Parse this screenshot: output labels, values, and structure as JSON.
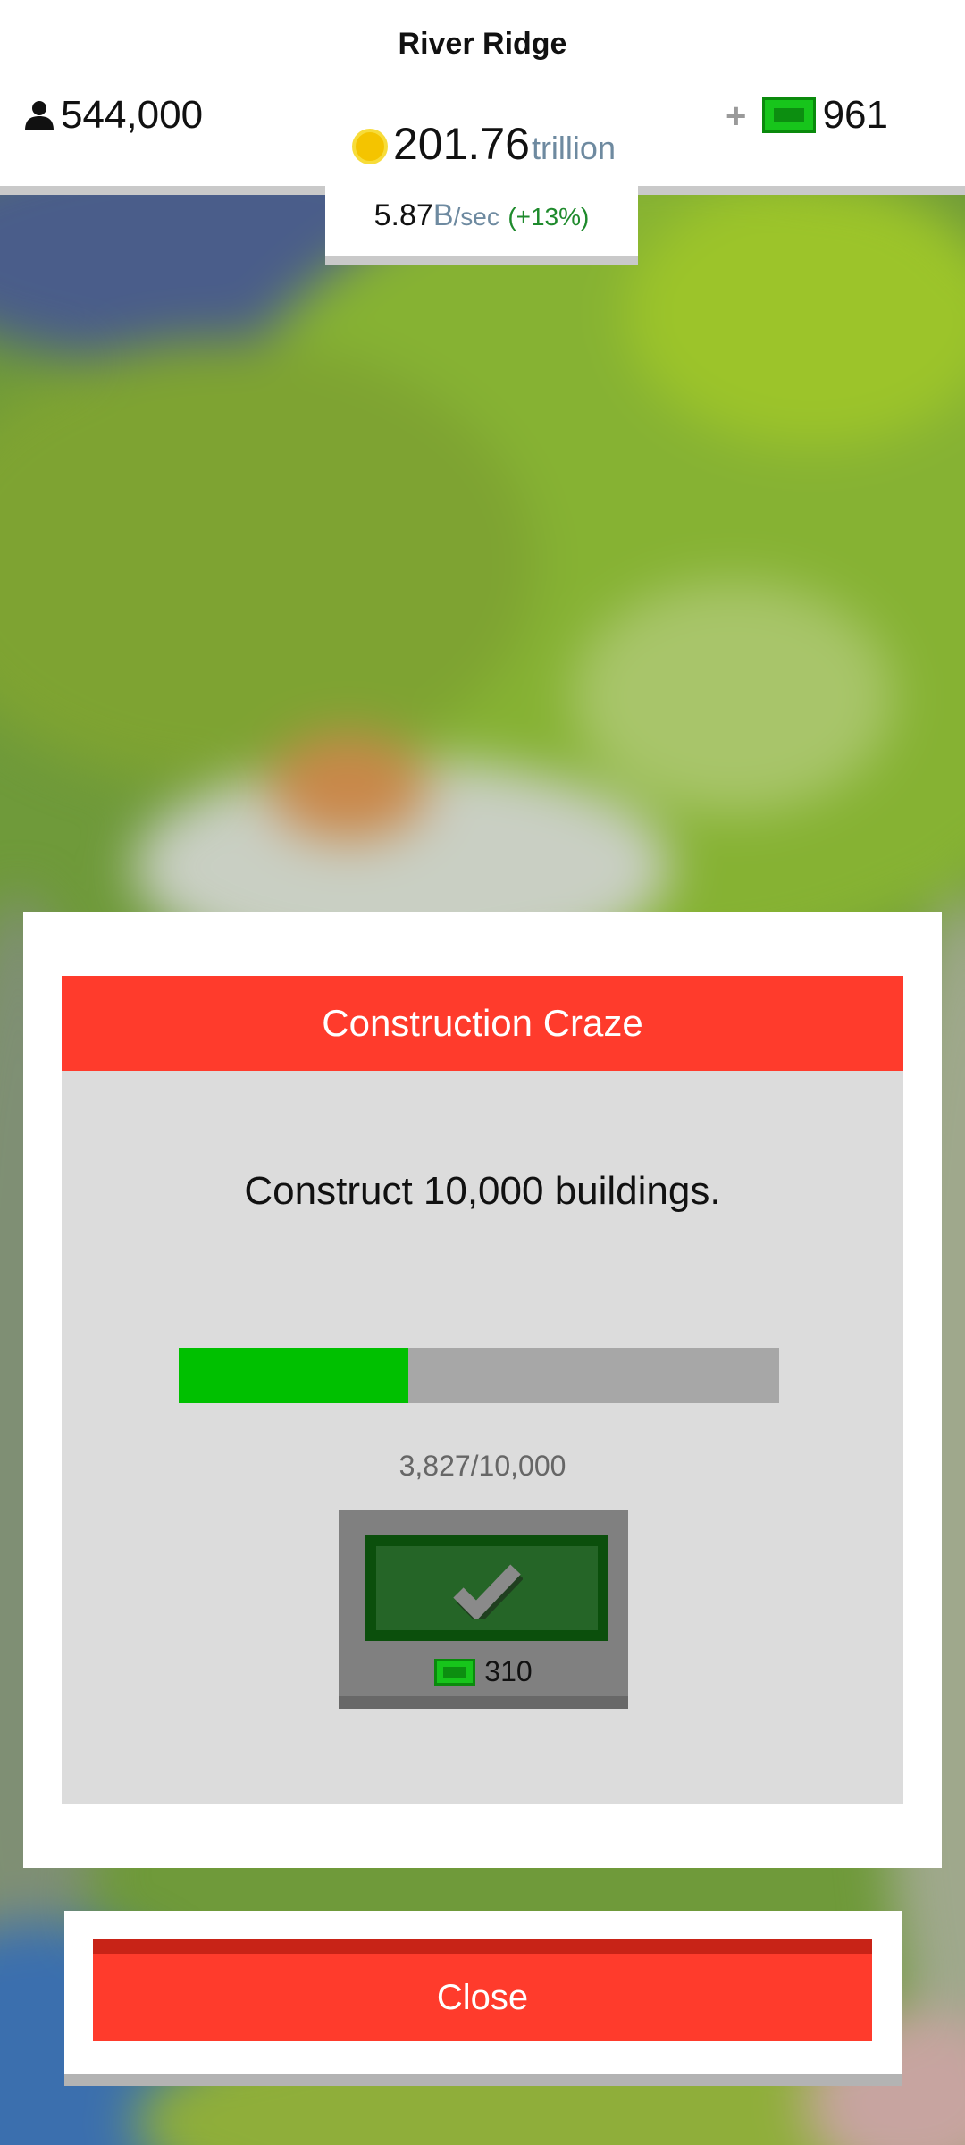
{
  "header": {
    "city_name": "River Ridge",
    "population": "544,000",
    "cash_plus": "+",
    "cash": "961",
    "money_value": "201.76",
    "money_unit": "trillion",
    "rate_value": "5.87",
    "rate_unit": "B",
    "rate_per": "/sec",
    "rate_bonus": "(+13%)"
  },
  "achievement": {
    "title": "Construction Craze",
    "description": "Construct 10,000 buildings.",
    "progress_text": "3,827/10,000",
    "progress_fraction": 0.3827,
    "reward_cost": "310"
  },
  "close_label": "Close",
  "colors": {
    "accent_red": "#ff3b2c",
    "progress_green": "#00c000",
    "cash_green": "#17c51b",
    "coin_yellow": "#f4c400"
  },
  "icons": {
    "population": "person-icon",
    "cash": "cash-bill-icon",
    "coin": "coin-icon",
    "claim": "checkmark-icon"
  }
}
